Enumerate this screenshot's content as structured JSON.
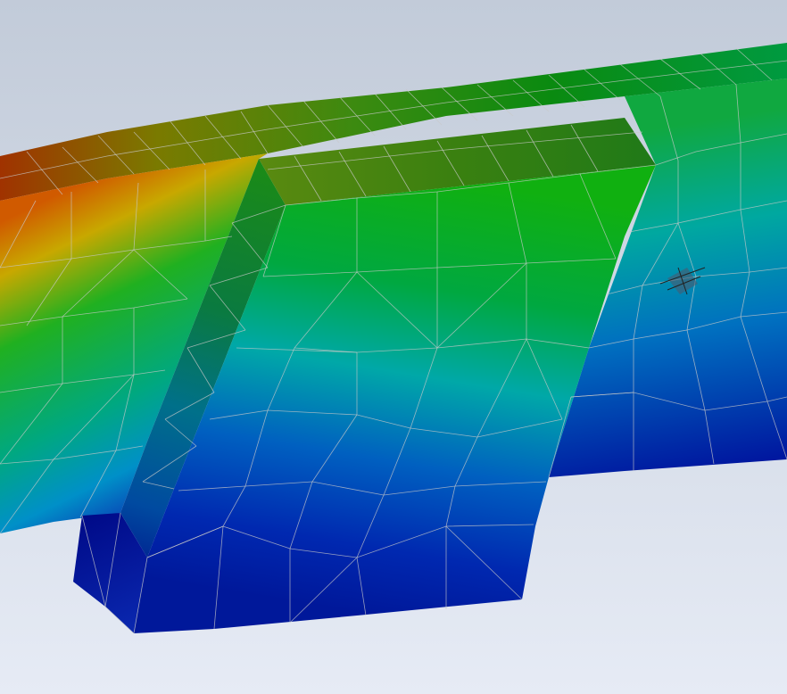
{
  "viewport": {
    "background_top": "#c2cbd9",
    "background_bottom": "#e6ebf5",
    "mesh_color": "#c8c8c8"
  },
  "model": {
    "colormap": [
      "#00008c",
      "#0a3cb4",
      "#00a0b4",
      "#0aaa28",
      "#009628",
      "#b4b400",
      "#dc7800",
      "#a03200"
    ],
    "parts": [
      "beam",
      "block",
      "block-side",
      "block-top",
      "mesh-defect"
    ]
  }
}
